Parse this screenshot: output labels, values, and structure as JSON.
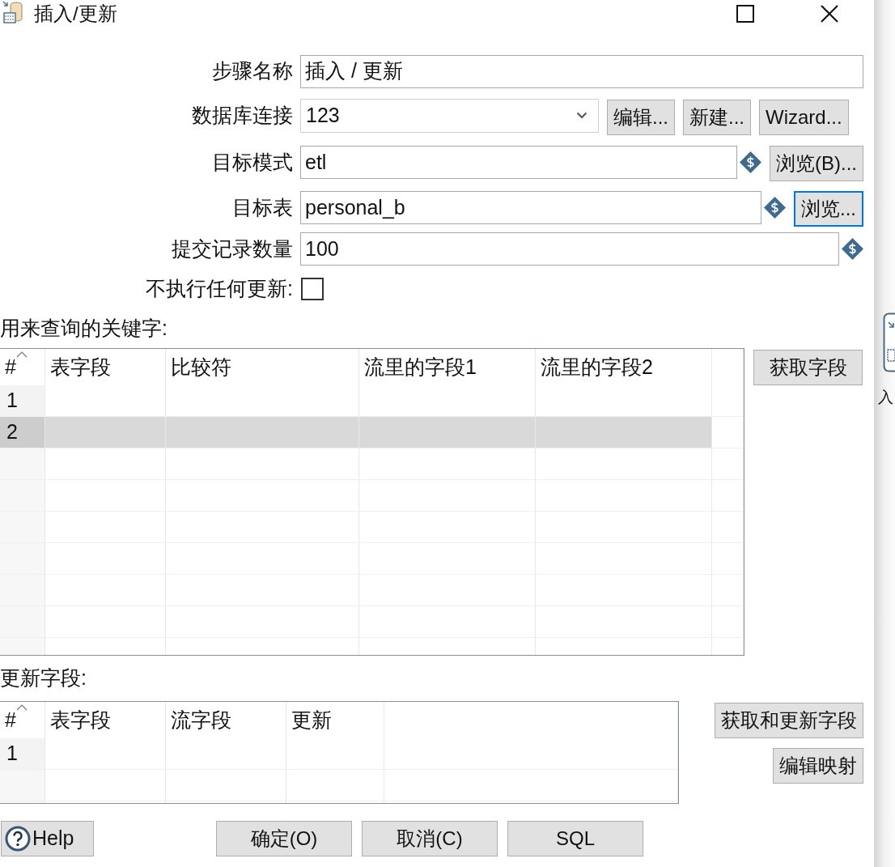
{
  "window": {
    "title": "插入/更新"
  },
  "form": {
    "fields": [
      {
        "kind": "text",
        "label": "步骤名称",
        "value": "插入 / 更新",
        "variable": false
      },
      {
        "kind": "combo",
        "label": "数据库连接",
        "value": "123",
        "buttons": [
          {
            "label": "编辑...",
            "focused": false
          },
          {
            "label": "新建...",
            "focused": false
          },
          {
            "label": "Wizard...",
            "focused": false
          }
        ]
      },
      {
        "kind": "text",
        "label": "目标模式",
        "value": "etl",
        "variable": true,
        "buttons": [
          {
            "label": "浏览(B)...",
            "focused": false
          }
        ]
      },
      {
        "kind": "text",
        "label": "目标表",
        "value": "personal_b",
        "variable": true,
        "buttons": [
          {
            "label": "浏览...",
            "focused": true
          }
        ]
      },
      {
        "kind": "text",
        "label": "提交记录数量",
        "value": "100",
        "variable": true
      },
      {
        "kind": "checkbox",
        "label": "不执行任何更新:",
        "checked": false
      }
    ]
  },
  "key_table": {
    "label": "用来查询的关键字:",
    "columns": [
      "#",
      "表字段",
      "比较符",
      "流里的字段1",
      "流里的字段2"
    ],
    "rows": [
      {
        "number": "1",
        "selected": false
      },
      {
        "number": "2",
        "selected": true
      }
    ],
    "button": "获取字段"
  },
  "update_table": {
    "label": "更新字段:",
    "columns": [
      "#",
      "表字段",
      "流字段",
      "更新"
    ],
    "rows": [
      {
        "number": "1",
        "selected": false
      }
    ],
    "buttons": [
      "获取和更新字段",
      "编辑映射"
    ]
  },
  "footer": {
    "help": "Help",
    "buttons": [
      "确定(O)",
      "取消(C)",
      "SQL"
    ]
  },
  "background": {
    "label": "入"
  }
}
